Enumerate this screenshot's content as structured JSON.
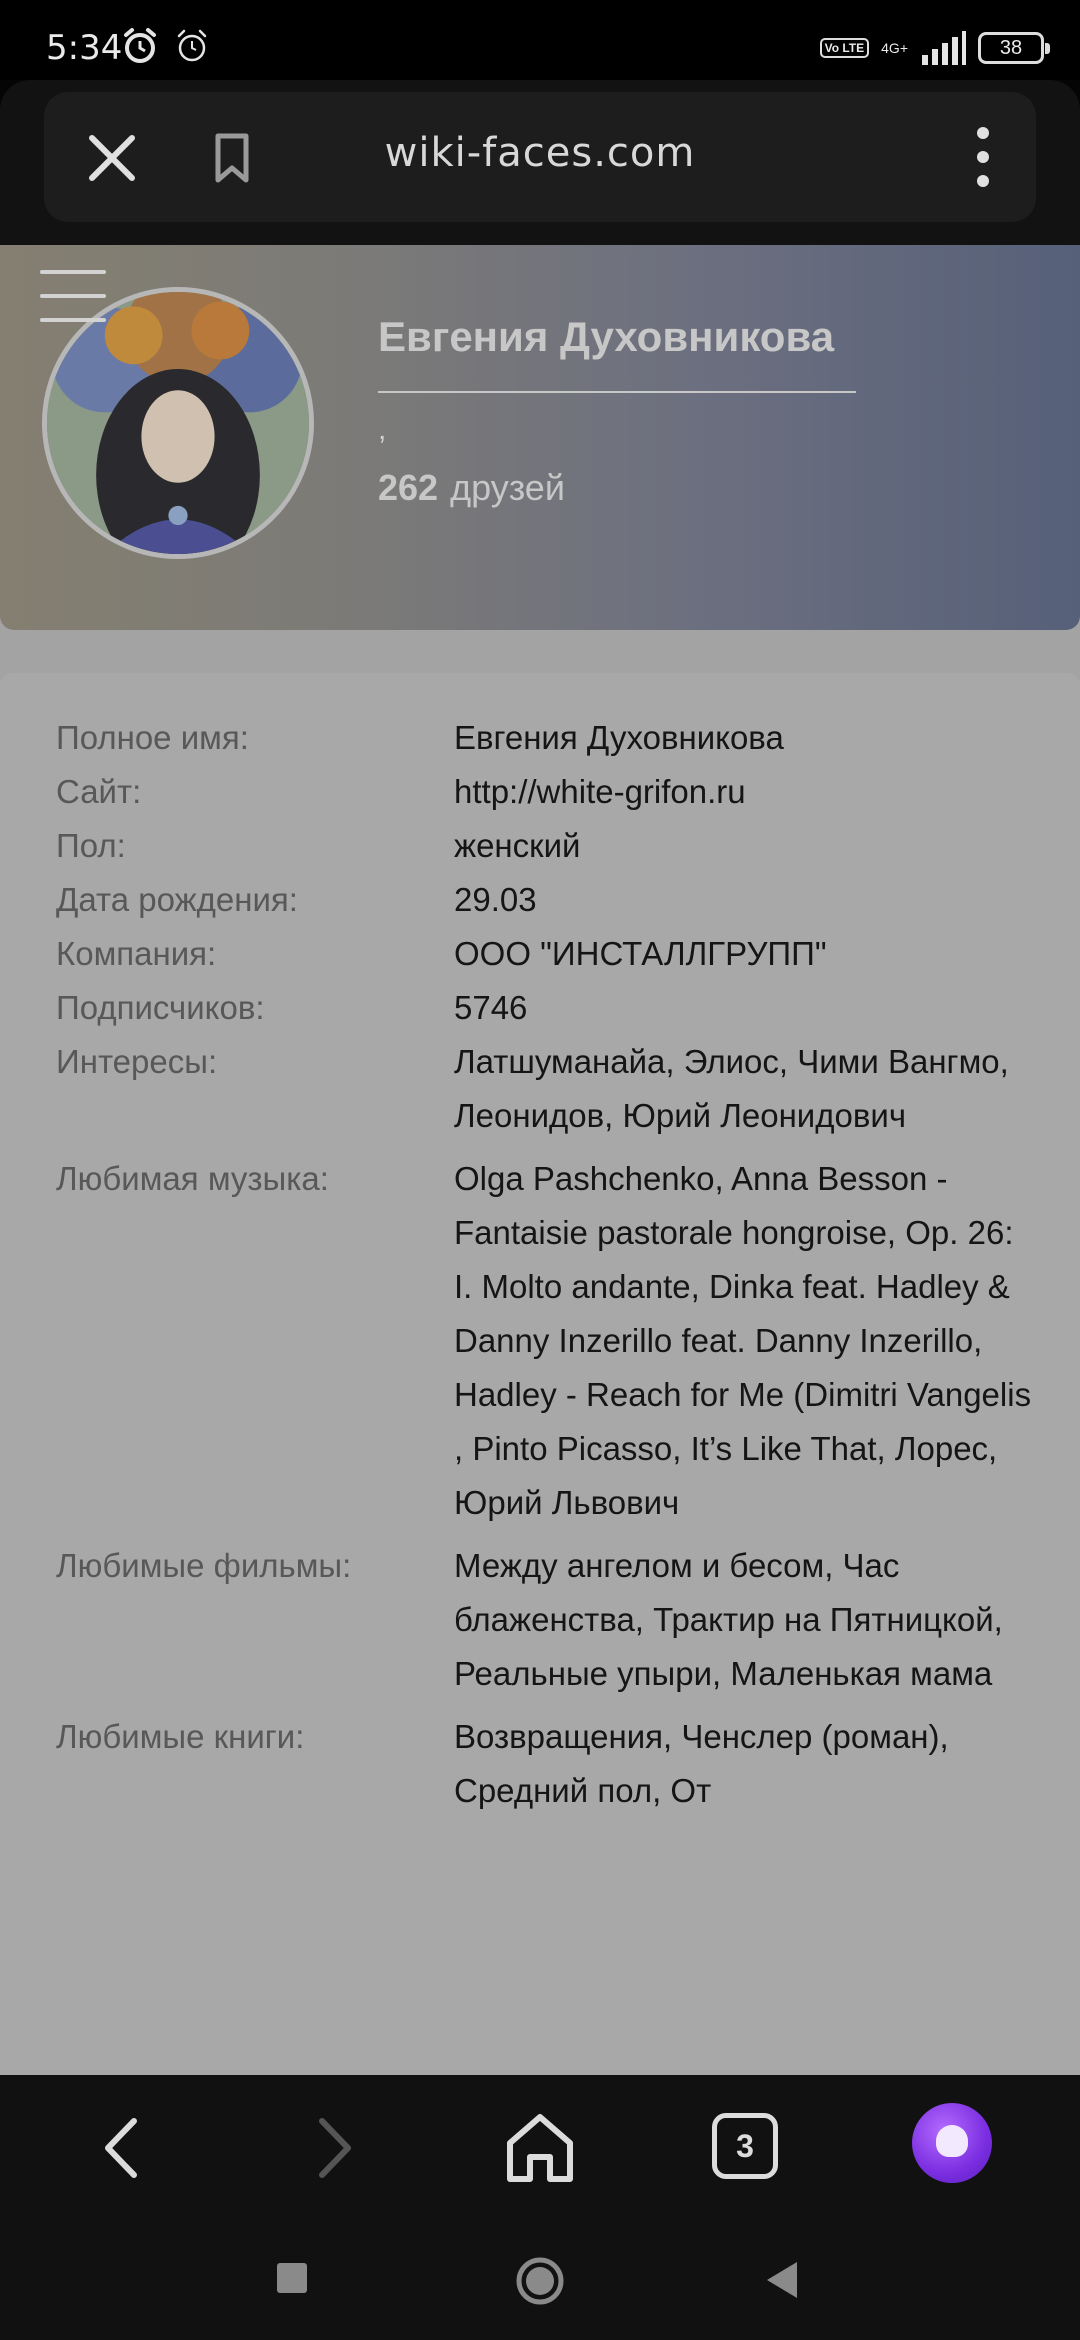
{
  "status_bar": {
    "time": "5:34",
    "volte": "Vo LTE",
    "network": "4G+",
    "battery": "38"
  },
  "browser": {
    "url": "wiki-faces.com",
    "tab_count": "3"
  },
  "profile": {
    "name": "Евгения Духовникова",
    "comma": ",",
    "friends_count": "262",
    "friends_label": "друзей"
  },
  "info": [
    {
      "label": "Полное имя:",
      "value": "Евгения Духовникова"
    },
    {
      "label": "Сайт:",
      "value": "http://white-grifon.ru"
    },
    {
      "label": "Пол:",
      "value": "женский"
    },
    {
      "label": "Дата рождения:",
      "value": "29.03"
    },
    {
      "label": "Компания:",
      "value": "ООО \"ИНСТАЛЛГРУПП\""
    },
    {
      "label": "Подписчиков:",
      "value": "5746"
    },
    {
      "label": "Интересы:",
      "value": "Латшуманайа, Элиос, Чими Вангмо, Леонидов, Юрий Леонидович"
    },
    {
      "label": "Любимая музыка:",
      "value": "Olga Pashchenko, Anna Besson - Fantaisie pastorale hongroise, Op. 26: I. Molto andante, Dinka feat. Hadley & Danny Inzerillo feat. Danny Inzerillo, Hadley - Reach for Me (Dimitri Vangelis , Pinto Picasso, It’s Like That, Лорес, Юрий Львович"
    },
    {
      "label": "Любимые фильмы:",
      "value": "Между ангелом и бесом, Час блаженства, Трактир на Пятницкой, Реальные упыри, Маленькая мама"
    },
    {
      "label": "Любимые книги:",
      "value": "Возвращения, Ченслер (роман), Средний пол, От"
    }
  ],
  "colors": {
    "accent_alice": "#7a2ee0",
    "overlay_page": "#a3a3a3"
  }
}
